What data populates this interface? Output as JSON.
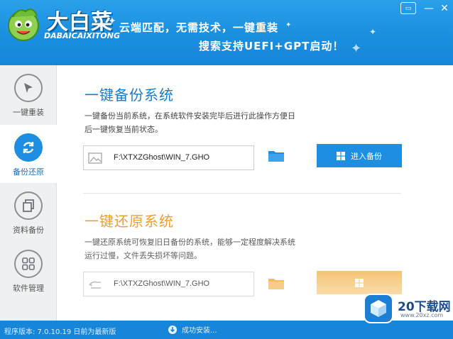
{
  "header": {
    "logo_title": "大白菜",
    "logo_sub": "DABAICAIXITONG",
    "slogan_line1": "云端匹配，无需技术，一键重装",
    "slogan_line2": "搜索支持UEFI+GPT启动！",
    "window_buttons": {
      "chat": "▭",
      "minimize": "—",
      "close": "✕"
    }
  },
  "sidebar": {
    "items": [
      {
        "label": "一键重装",
        "icon": "cursor-icon",
        "active": false
      },
      {
        "label": "备份还原",
        "icon": "refresh-icon",
        "active": true
      },
      {
        "label": "资料备份",
        "icon": "copy-icon",
        "active": false
      },
      {
        "label": "软件管理",
        "icon": "apps-grid-icon",
        "active": false
      }
    ]
  },
  "backup": {
    "title": "一键备份系统",
    "desc": "一键备份当前系统，在系统软件安装完毕后进行此操作方便日后一键恢复当前状态。",
    "path": "F:\\XTXZGhost\\WIN_7.GHO",
    "button_label": "进入备份"
  },
  "restore": {
    "title": "一键还原系统",
    "desc": "一键还原系统可恢复旧日备份的系统，能够一定程度解决系统运行过慢，文件丢失损坏等问题。",
    "path": "F:\\XTXZGhost\\WIN_7.GHO"
  },
  "statusbar": {
    "version": "程序版本: 7.0.10.19 日前为最新版",
    "middle": "成功安装..."
  },
  "watermark": {
    "brand": "20下载网",
    "url": "www.20xz.com"
  },
  "colors": {
    "header_blue": "#1b8fdf",
    "accent_blue": "#1d8ee0",
    "title_blue": "#1a7bc9",
    "orange_button": "#f2b451"
  }
}
